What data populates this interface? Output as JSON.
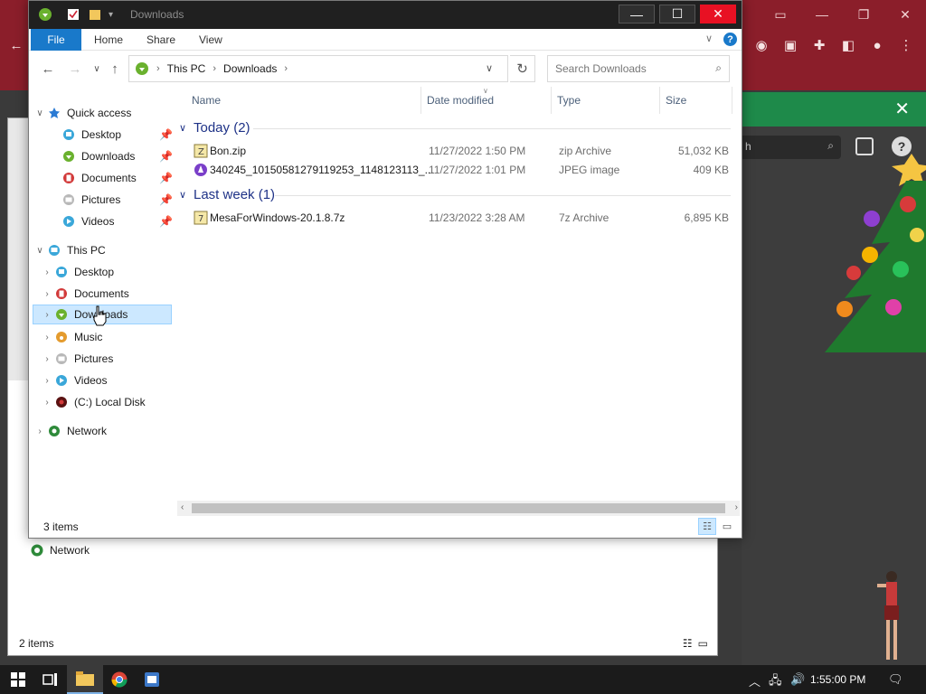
{
  "explorer": {
    "title": "Downloads",
    "ribbon_tabs": [
      "File",
      "Home",
      "Share",
      "View"
    ],
    "breadcrumb": [
      "This PC",
      "Downloads"
    ],
    "search_placeholder": "Search Downloads",
    "columns": [
      "Name",
      "Date modified",
      "Type",
      "Size"
    ],
    "groups": [
      {
        "label": "Today (2)",
        "files": [
          {
            "name": "Bon.zip",
            "date": "11/27/2022 1:50 PM",
            "type": "zip Archive",
            "size": "51,032 KB",
            "icon": "zip-archive-icon"
          },
          {
            "name": "340245_10150581279119253_1148123113_...",
            "date": "11/27/2022 1:01 PM",
            "type": "JPEG image",
            "size": "409 KB",
            "icon": "jpeg-image-icon"
          }
        ]
      },
      {
        "label": "Last week (1)",
        "files": [
          {
            "name": "MesaForWindows-20.1.8.7z",
            "date": "11/23/2022 3:28 AM",
            "type": "7z Archive",
            "size": "6,895 KB",
            "icon": "7z-archive-icon"
          }
        ]
      }
    ],
    "nav": {
      "quick_access": "Quick access",
      "quick_items": [
        "Desktop",
        "Downloads",
        "Documents",
        "Pictures",
        "Videos"
      ],
      "this_pc": "This PC",
      "pc_items": [
        "Desktop",
        "Documents",
        "Downloads",
        "Music",
        "Pictures",
        "Videos",
        "(C:) Local Disk"
      ],
      "network": "Network",
      "selected": "Downloads"
    },
    "status_count": "3 items"
  },
  "back_window": {
    "network_label": "Network",
    "status_count": "2 items"
  },
  "taskbar": {
    "clock": "1:55:00 PM"
  },
  "colors": {
    "accent": "#1979ca",
    "selection": "#cce8ff",
    "titlebar": "#202020",
    "close_button": "#e81123",
    "browser_bg": "#8b1e2a",
    "green_bar": "#1e8a4a"
  }
}
